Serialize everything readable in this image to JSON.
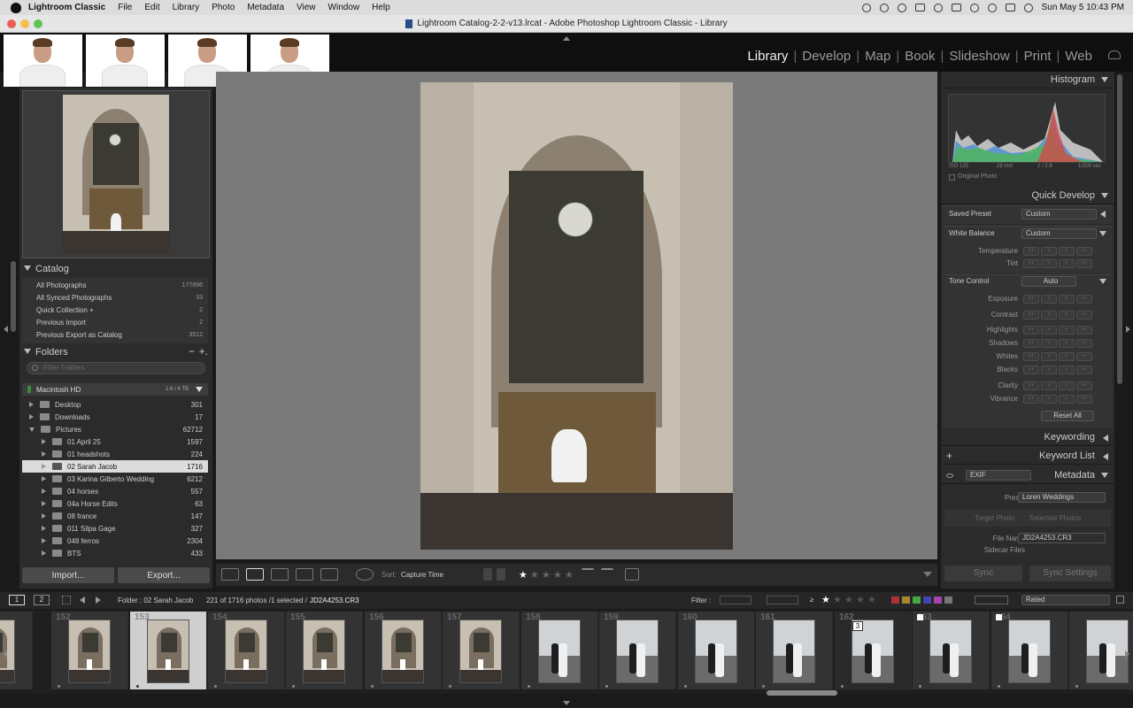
{
  "menubar": {
    "app": "Lightroom Classic",
    "items": [
      "File",
      "Edit",
      "Library",
      "Photo",
      "Metadata",
      "View",
      "Window",
      "Help"
    ],
    "datetime": "Sun May 5  10:43 PM"
  },
  "window": {
    "title": "Lightroom Catalog-2-2-v13.lrcat - Adobe Photoshop Lightroom Classic - Library"
  },
  "modules": [
    {
      "label": "Library",
      "active": true
    },
    {
      "label": "Develop"
    },
    {
      "label": "Map"
    },
    {
      "label": "Book"
    },
    {
      "label": "Slideshow"
    },
    {
      "label": "Print"
    },
    {
      "label": "Web"
    }
  ],
  "left_panel": {
    "catalog": {
      "title": "Catalog",
      "items": [
        {
          "label": "All Photographs",
          "count": "177896"
        },
        {
          "label": "All Synced Photographs",
          "count": "33"
        },
        {
          "label": "Quick Collection  +",
          "count": "2"
        },
        {
          "label": "Previous Import",
          "count": "2"
        },
        {
          "label": "Previous Export as Catalog",
          "count": "3512"
        }
      ]
    },
    "folders": {
      "title": "Folders",
      "add": "+.",
      "remove": "−",
      "search_placeholder": "Filter Folders",
      "volume": {
        "name": "Macintosh HD",
        "size": "1.6 / 4 TB"
      },
      "items": [
        {
          "label": "Desktop",
          "count": "301",
          "level": 1,
          "expanded": false
        },
        {
          "label": "Downloads",
          "count": "17",
          "level": 1,
          "expanded": false
        },
        {
          "label": "Pictures",
          "count": "62712",
          "level": 1,
          "expanded": true
        },
        {
          "label": "01 April 25",
          "count": "1597",
          "level": 2
        },
        {
          "label": "01 headshots",
          "count": "224",
          "level": 2
        },
        {
          "label": "02 Sarah Jacob",
          "count": "1716",
          "level": 2,
          "selected": true
        },
        {
          "label": "03 Karina Gilberto Wedding",
          "count": "6212",
          "level": 2
        },
        {
          "label": "04 horses",
          "count": "557",
          "level": 2
        },
        {
          "label": "04a Horse Edits",
          "count": "63",
          "level": 2
        },
        {
          "label": "08 france",
          "count": "147",
          "level": 2
        },
        {
          "label": "011 Silpa Gage",
          "count": "327",
          "level": 2
        },
        {
          "label": "048 ferros",
          "count": "2304",
          "level": 2
        },
        {
          "label": "BTS",
          "count": "433",
          "level": 2
        }
      ]
    },
    "import_label": "Import...",
    "export_label": "Export..."
  },
  "toolbar": {
    "sort_label": "Sort:",
    "sort_value": "Capture Time",
    "rating": 1
  },
  "right_panel": {
    "histogram": {
      "title": "Histogram",
      "iso": "ISO 125",
      "focal": "28 mm",
      "aperture": "ƒ / 2.8",
      "shutter": "1/200 sec",
      "original_photo": "Original Photo"
    },
    "quick_develop": {
      "title": "Quick Develop",
      "saved_preset_label": "Saved Preset",
      "saved_preset_value": "Custom",
      "white_balance_label": "White Balance",
      "white_balance_value": "Custom",
      "temperature": "Temperature",
      "tint": "Tint",
      "tone_control": "Tone Control",
      "auto": "Auto",
      "exposure": "Exposure",
      "contrast": "Contrast",
      "highlights": "Highlights",
      "shadows": "Shadows",
      "whites": "Whites",
      "blacks": "Blacks",
      "clarity": "Clarity",
      "vibrance": "Vibrance",
      "reset_all": "Reset All"
    },
    "keywording": "Keywording",
    "keyword_list": "Keyword List",
    "keyword_add": "+",
    "metadata": {
      "title": "Metadata",
      "view": "EXIF",
      "preset_label": "Preset",
      "preset_value": "Loren Weddings",
      "target_photo": "Target Photo",
      "selected_photos": "Selected Photos",
      "file_name_label": "File Name",
      "file_name_value": "JD2A4253.CR3",
      "sidecar_label": "Sidecar Files"
    },
    "sync_label": "Sync",
    "sync_settings_label": "Sync Settings"
  },
  "filmstrip_header": {
    "page1": "1",
    "page2": "2",
    "folder": "Folder : 02 Sarah Jacob",
    "counts": "221 of 1716 photos /1 selected /",
    "file": "JD2A4253.CR3",
    "filter_label": "Filter :",
    "filter_value": "Rated",
    "gte": "≥"
  },
  "filmstrip": [
    {
      "num": "",
      "kind": "arch"
    },
    {
      "num": "152",
      "kind": "arch"
    },
    {
      "num": "153",
      "kind": "arch",
      "selected": true
    },
    {
      "num": "154",
      "kind": "arch"
    },
    {
      "num": "155",
      "kind": "arch"
    },
    {
      "num": "156",
      "kind": "arch"
    },
    {
      "num": "157",
      "kind": "arch"
    },
    {
      "num": "158",
      "kind": "city"
    },
    {
      "num": "159",
      "kind": "city"
    },
    {
      "num": "160",
      "kind": "city"
    },
    {
      "num": "161",
      "kind": "city"
    },
    {
      "num": "162",
      "kind": "city",
      "badge": "3"
    },
    {
      "num": "163",
      "kind": "city",
      "flag": true
    },
    {
      "num": "164",
      "kind": "city",
      "flag": true
    },
    {
      "num": "",
      "kind": "city"
    }
  ],
  "colors": {
    "panel": "#2b2b2b",
    "center_bg": "#7a7a7a",
    "active_module": "#f2f2f2"
  }
}
